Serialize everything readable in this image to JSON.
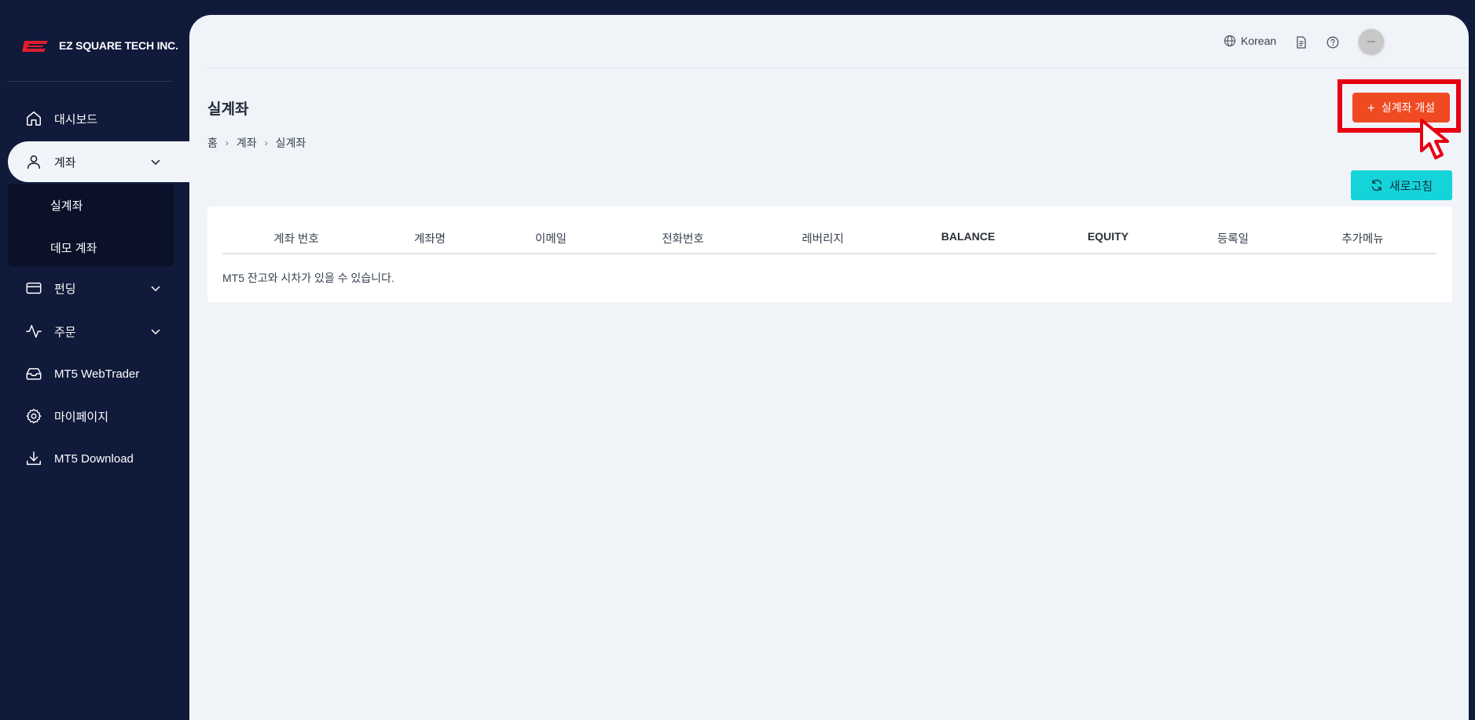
{
  "brand": {
    "name": "EZ SQUARE TECH INC.",
    "logo_text": "EZ"
  },
  "sidebar": {
    "items": [
      {
        "label": "대시보드",
        "icon": "home-icon"
      },
      {
        "label": "계좌",
        "icon": "user-icon",
        "expanded": true,
        "children": [
          {
            "label": "실계좌"
          },
          {
            "label": "데모 계좌"
          }
        ]
      },
      {
        "label": "펀딩",
        "icon": "credit-card-icon"
      },
      {
        "label": "주문",
        "icon": "activity-icon"
      },
      {
        "label": "MT5 WebTrader",
        "icon": "inbox-icon"
      },
      {
        "label": "마이페이지",
        "icon": "gear-icon"
      },
      {
        "label": "MT5 Download",
        "icon": "download-icon"
      }
    ]
  },
  "header": {
    "language": "Korean"
  },
  "page": {
    "title": "실계좌",
    "breadcrumb": [
      "홈",
      "계좌",
      "실계좌"
    ],
    "open_account_label": "실계좌 개설",
    "refresh_label": "새로고침"
  },
  "table": {
    "columns": [
      "계좌 번호",
      "계좌명",
      "이메일",
      "전화번호",
      "레버리지",
      "BALANCE",
      "EQUITY",
      "등록일",
      "추가메뉴"
    ],
    "notice": "MT5 잔고와 시차가 있을 수 있습니다."
  },
  "colors": {
    "sidebar_bg": "#101a3a",
    "main_bg": "#f0f3f8",
    "open_button": "#f04a23",
    "highlight_box": "#e60012",
    "refresh_button": "#14d4da"
  }
}
